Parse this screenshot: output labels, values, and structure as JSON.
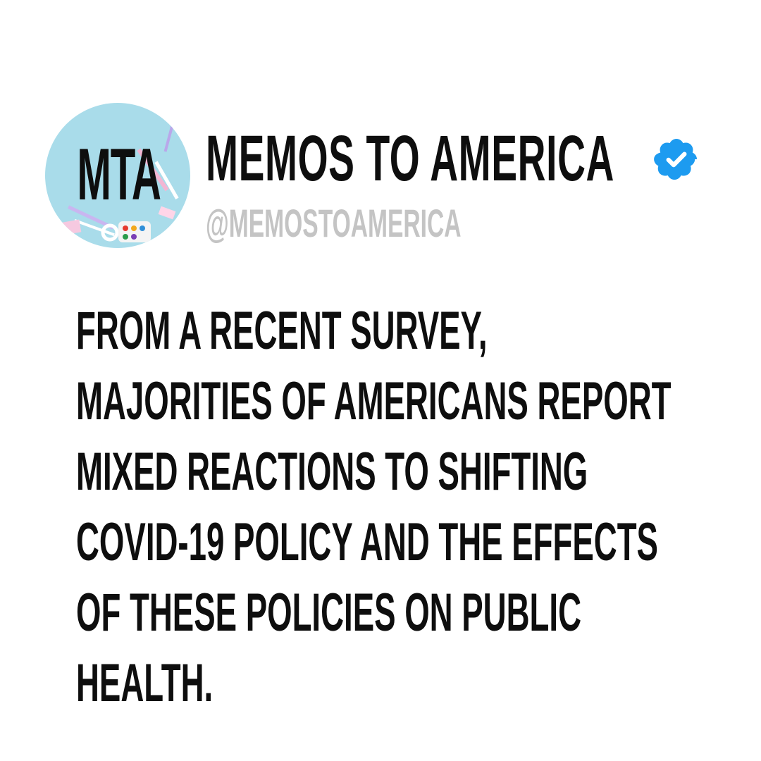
{
  "profile": {
    "avatar_text": "MTA",
    "display_name": "MEMOS TO AMERICA",
    "handle": "@MEMOSTOAMERICA",
    "verified_icon": "verified-badge-icon",
    "badge_color": "#1d9bf0"
  },
  "post": {
    "lines": [
      "FROM A RECENT SURVEY,",
      "MAJORITIES OF AMERICANS REPORT",
      "MIXED REACTIONS TO SHIFTING",
      "COVID-19 POLICY AND THE EFFECTS",
      "OF THESE POLICIES ON PUBLIC",
      "HEALTH."
    ]
  }
}
